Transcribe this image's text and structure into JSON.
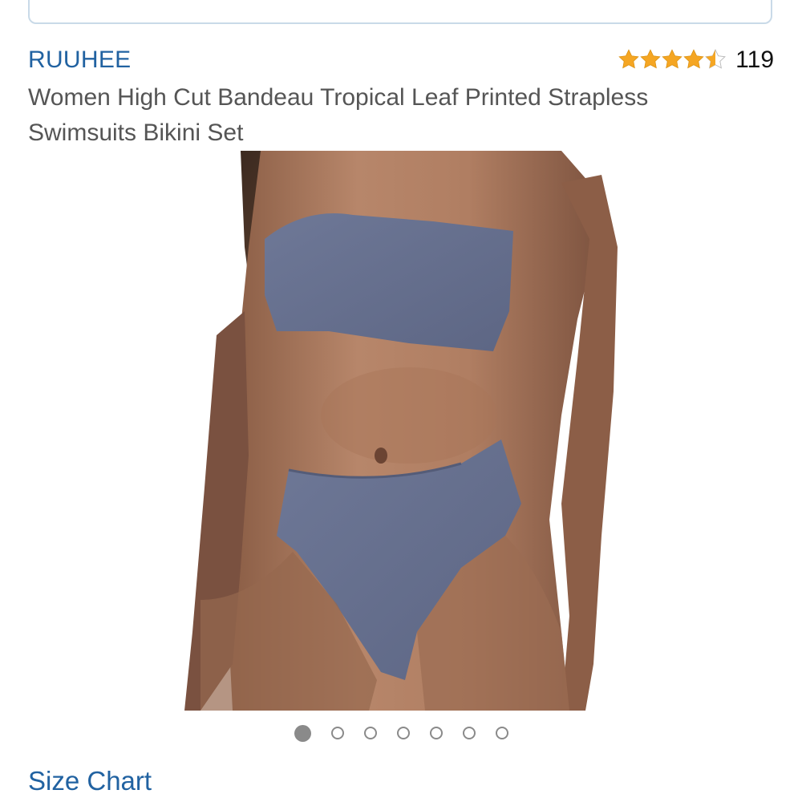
{
  "product": {
    "brand": "RUUHEE",
    "title": "Women High Cut Bandeau Tropical Leaf Printed Strapless Swimsuits Bikini Set",
    "rating": 4.5,
    "rating_count": "119",
    "image_description_icon": "product-photo"
  },
  "carousel": {
    "total": 7,
    "active_index": 0
  },
  "links": {
    "size_chart": "Size Chart"
  },
  "colors": {
    "link": "#2162a1",
    "star": "#f5a623",
    "swimsuit": "#66708f"
  }
}
